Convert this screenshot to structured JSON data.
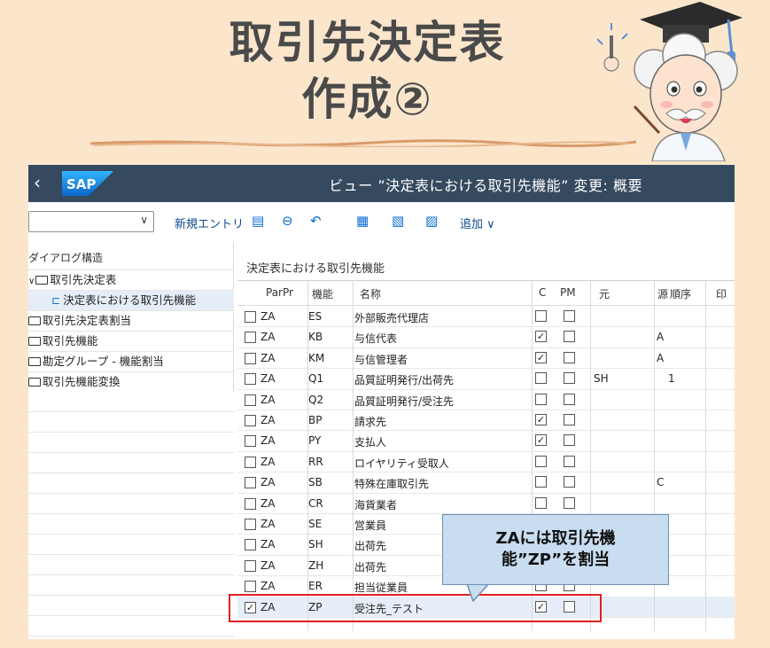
{
  "banner": {
    "title_line1": "取引先決定表",
    "title_line2": "作成②"
  },
  "header": {
    "back": "‹",
    "logo": "SAP",
    "title": "ビュー ”決定表における取引先機能” 変更: 概要"
  },
  "toolbar": {
    "select_value": "",
    "new_entry": "新規エントリ",
    "icons": [
      "copy-icon",
      "delete-icon",
      "undo-icon",
      "select-all-icon",
      "select-block-icon",
      "deselect-all-icon"
    ],
    "add": "追加 ∨"
  },
  "tree": {
    "title": "ダイアログ構造",
    "items": [
      {
        "label": "取引先決定表",
        "expanded": true
      },
      {
        "label": "決定表における取引先機能",
        "child": true,
        "selected": true
      },
      {
        "label": "取引先決定表割当"
      },
      {
        "label": "取引先機能"
      },
      {
        "label": "勘定グループ - 機能割当"
      },
      {
        "label": "取引先機能変換"
      }
    ]
  },
  "table": {
    "title": "決定表における取引先機能",
    "columns": [
      "ParPr",
      "機能",
      "名称",
      "C",
      "PM",
      "元",
      "源",
      "順序",
      "印"
    ],
    "rows": [
      {
        "sel": false,
        "parpr": "ZA",
        "func": "ES",
        "name": "外部販売代理店",
        "c": false,
        "pm": false,
        "src": "",
        "origin": "",
        "seq": ""
      },
      {
        "sel": false,
        "parpr": "ZA",
        "func": "KB",
        "name": "与信代表",
        "c": true,
        "pm": false,
        "src": "",
        "origin": "A",
        "seq": ""
      },
      {
        "sel": false,
        "parpr": "ZA",
        "func": "KM",
        "name": "与信管理者",
        "c": true,
        "pm": false,
        "src": "",
        "origin": "A",
        "seq": ""
      },
      {
        "sel": false,
        "parpr": "ZA",
        "func": "Q1",
        "name": "品質証明発行/出荷先",
        "c": false,
        "pm": false,
        "src": "SH",
        "origin": "",
        "seq": "1"
      },
      {
        "sel": false,
        "parpr": "ZA",
        "func": "Q2",
        "name": "品質証明発行/受注先",
        "c": false,
        "pm": false,
        "src": "",
        "origin": "",
        "seq": ""
      },
      {
        "sel": false,
        "parpr": "ZA",
        "func": "BP",
        "name": "請求先",
        "c": true,
        "pm": false,
        "src": "",
        "origin": "",
        "seq": ""
      },
      {
        "sel": false,
        "parpr": "ZA",
        "func": "PY",
        "name": "支払人",
        "c": true,
        "pm": false,
        "src": "",
        "origin": "",
        "seq": ""
      },
      {
        "sel": false,
        "parpr": "ZA",
        "func": "RR",
        "name": "ロイヤリティ受取人",
        "c": false,
        "pm": false,
        "src": "",
        "origin": "",
        "seq": ""
      },
      {
        "sel": false,
        "parpr": "ZA",
        "func": "SB",
        "name": "特殊在庫取引先",
        "c": false,
        "pm": false,
        "src": "",
        "origin": "C",
        "seq": ""
      },
      {
        "sel": false,
        "parpr": "ZA",
        "func": "CR",
        "name": "海貨業者",
        "c": false,
        "pm": false,
        "src": "",
        "origin": "",
        "seq": ""
      },
      {
        "sel": false,
        "parpr": "ZA",
        "func": "SE",
        "name": "営業員",
        "c": false,
        "pm": false,
        "src": "",
        "origin": "",
        "seq": ""
      },
      {
        "sel": false,
        "parpr": "ZA",
        "func": "SH",
        "name": "出荷先",
        "c": false,
        "pm": false,
        "src": "",
        "origin": "",
        "seq": ""
      },
      {
        "sel": false,
        "parpr": "ZA",
        "func": "ZH",
        "name": "出荷先",
        "c": false,
        "pm": false,
        "src": "",
        "origin": "",
        "seq": ""
      },
      {
        "sel": false,
        "parpr": "ZA",
        "func": "ER",
        "name": "担当従業員",
        "c": false,
        "pm": false,
        "src": "",
        "origin": "",
        "seq": ""
      },
      {
        "sel": true,
        "parpr": "ZA",
        "func": "ZP",
        "name": "受注先_テスト",
        "c": true,
        "pm": false,
        "src": "",
        "origin": "",
        "seq": "",
        "highlight": true
      }
    ]
  },
  "callout": {
    "line1": "ZAには取引先機",
    "line2": "能”ZP”を割当"
  },
  "colors": {
    "background": "#fbe6cc",
    "header": "#354a5f",
    "callout_fill": "#c9ddf1",
    "highlight_border": "#e02020",
    "selected_row": "#e5eef8"
  }
}
